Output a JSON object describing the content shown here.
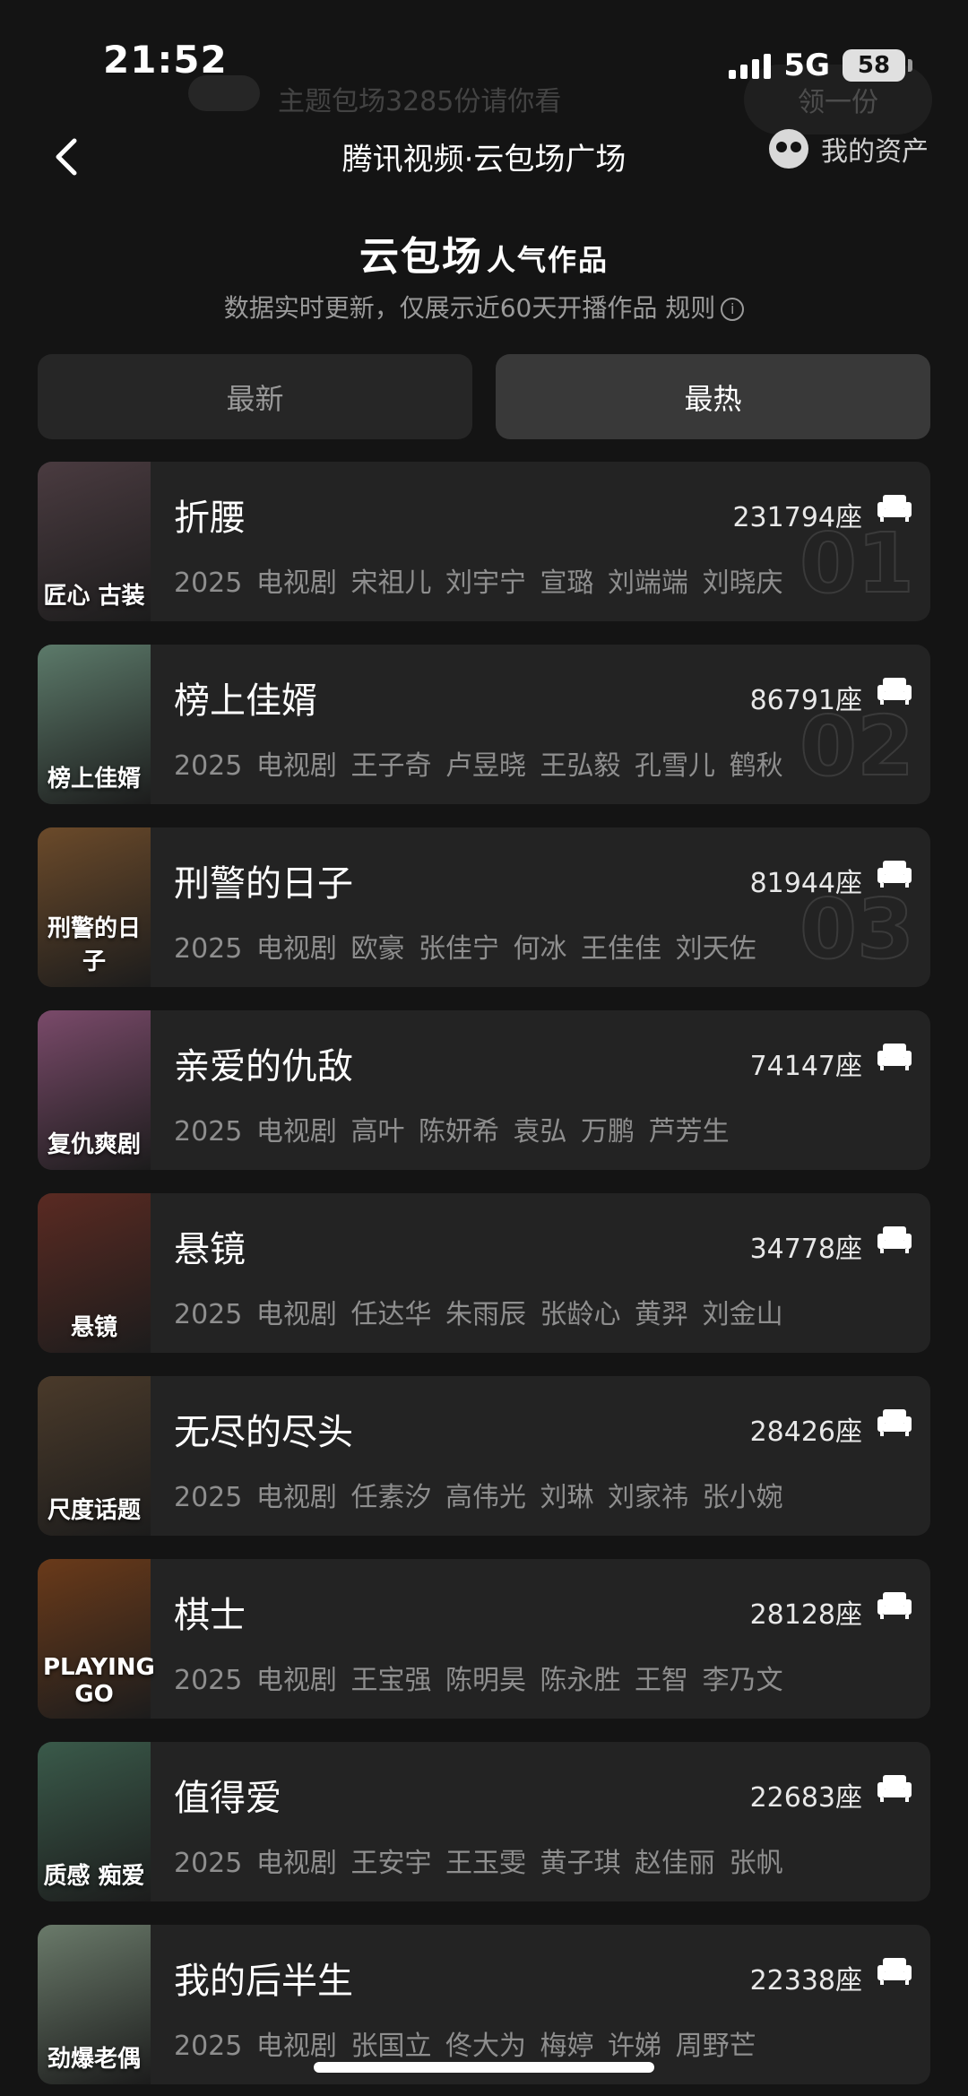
{
  "status_bar": {
    "time": "21:52",
    "network": "5G",
    "battery": "58"
  },
  "ghost_banner": {
    "text": "主题包场3285份请你看",
    "button": "领一份"
  },
  "nav": {
    "title": "腾讯视频·云包场广场",
    "assets_label": "我的资产"
  },
  "header": {
    "title_main": "云包场",
    "title_accent": "人气作品",
    "subtitle": "数据实时更新，仅展示近60天开播作品",
    "rules_label": "规则"
  },
  "tabs": [
    {
      "label": "最新"
    },
    {
      "label": "最热"
    }
  ],
  "seat_unit": "座",
  "items": [
    {
      "title": "折腰",
      "year": "2025",
      "genre": "电视剧",
      "cast": "宋祖儿 刘宇宁 宣璐 刘端端 刘晓庆",
      "seats": "231794",
      "rank": "01",
      "poster_text": "匠心 古装",
      "poster_color": "#4a3b40"
    },
    {
      "title": "榜上佳婿",
      "year": "2025",
      "genre": "电视剧",
      "cast": "王子奇 卢昱晓 王弘毅 孔雪儿 鹤秋",
      "seats": "86791",
      "rank": "02",
      "poster_text": "榜上佳婿",
      "poster_color": "#5c7a6a"
    },
    {
      "title": "刑警的日子",
      "year": "2025",
      "genre": "电视剧",
      "cast": "欧豪 张佳宁 何冰 王佳佳 刘天佐",
      "seats": "81944",
      "rank": "03",
      "poster_text": "刑警的日子",
      "poster_color": "#6b4a2a"
    },
    {
      "title": "亲爱的仇敌",
      "year": "2025",
      "genre": "电视剧",
      "cast": "高叶 陈妍希 袁弘 万鹏 芦芳生",
      "seats": "74147",
      "rank": "",
      "poster_text": "复仇爽剧",
      "poster_color": "#7a4a6a"
    },
    {
      "title": "悬镜",
      "year": "2025",
      "genre": "电视剧",
      "cast": "任达华 朱雨辰 张龄心 黄羿 刘金山",
      "seats": "34778",
      "rank": "",
      "poster_text": "悬镜",
      "poster_color": "#5a2a22"
    },
    {
      "title": "无尽的尽头",
      "year": "2025",
      "genre": "电视剧",
      "cast": "任素汐 高伟光 刘琳 刘家祎 张小婉",
      "seats": "28426",
      "rank": "",
      "poster_text": "尺度话题",
      "poster_color": "#4a3a2a"
    },
    {
      "title": "棋士",
      "year": "2025",
      "genre": "电视剧",
      "cast": "王宝强 陈明昊 陈永胜 王智 李乃文",
      "seats": "28128",
      "rank": "",
      "poster_text": "PLAYING GO",
      "poster_color": "#6a3a1a"
    },
    {
      "title": "值得爱",
      "year": "2025",
      "genre": "电视剧",
      "cast": "王安宇 王玉雯 黄子琪 赵佳丽 张帆",
      "seats": "22683",
      "rank": "",
      "poster_text": "质感 痴爱",
      "poster_color": "#3a5a4a"
    },
    {
      "title": "我的后半生",
      "year": "2025",
      "genre": "电视剧",
      "cast": "张国立 佟大为 梅婷 许娣 周野芒",
      "seats": "22338",
      "rank": "",
      "poster_text": "劲爆老偶",
      "poster_color": "#6a7a6a"
    }
  ]
}
